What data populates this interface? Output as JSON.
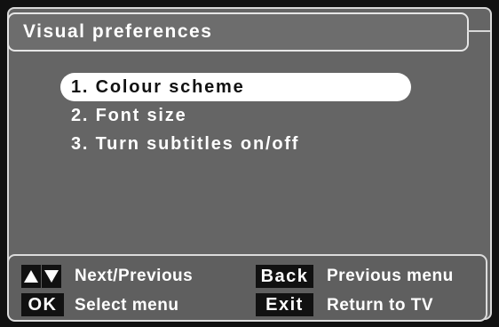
{
  "header": {
    "title": "Visual preferences"
  },
  "menu": {
    "items": [
      {
        "label": "1. Colour scheme",
        "selected": true
      },
      {
        "label": "2. Font size",
        "selected": false
      },
      {
        "label": "3. Turn subtitles on/off",
        "selected": false
      }
    ]
  },
  "footer": {
    "hint_nav": "Next/Previous",
    "key_ok": "OK",
    "hint_select": "Select menu",
    "key_back": "Back",
    "hint_back": "Previous menu",
    "key_exit": "Exit",
    "hint_exit": "Return to TV",
    "nav_icons": [
      "up-arrow-icon",
      "down-arrow-icon"
    ]
  },
  "colors": {
    "background": "#111111",
    "panel": "#656565",
    "highlight": "#ffffff",
    "text": "#ffffff"
  }
}
